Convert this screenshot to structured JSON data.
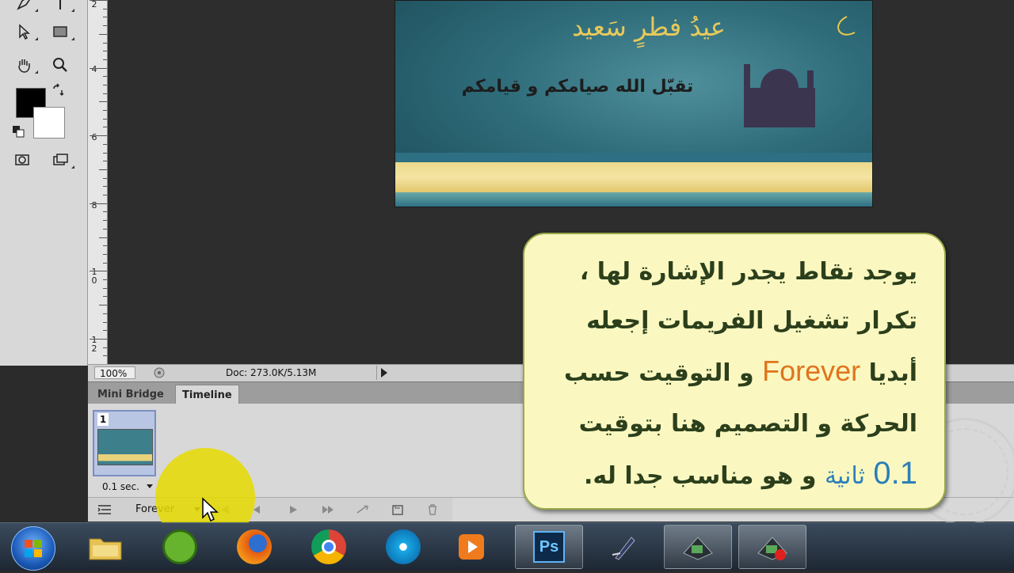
{
  "ruler": {
    "labels": [
      "2",
      "4",
      "6",
      "8",
      "10",
      "12"
    ]
  },
  "banner": {
    "title": "عيدُ فطرٍ سَعيد",
    "subtitle": "تقبّل الله صيامكم و قيامكم"
  },
  "status": {
    "zoom": "100%",
    "doc": "Doc: 273.0K/5.13M"
  },
  "panels": {
    "tabs": [
      "Mini Bridge",
      "Timeline"
    ]
  },
  "timeline": {
    "frame_number": "1",
    "frame_delay": "0.1 sec.",
    "loop": "Forever"
  },
  "bubble": {
    "line1": "يوجد نقاط يجدر الإشارة لها ،",
    "line2": "تكرار تشغيل الفريمات إجعله",
    "line3_pre": "أبديا",
    "line3_accent": "Forever",
    "line3_post": "و التوقيت حسب",
    "line4": "الحركة و التصميم هنا بتوقيت",
    "line5_num": "0.1",
    "line5_accent": "ثانية",
    "line5_post": "و هو مناسب جدا له."
  },
  "colors": {
    "bubble_bg": "#faf8c0",
    "accent_orange": "#e0741d",
    "accent_blue": "#2d7fb8",
    "highlight": "#e6dc00"
  },
  "icons": {
    "taskbar": [
      "windows-start-icon",
      "file-explorer-icon",
      "utorrent-icon",
      "firefox-icon",
      "chrome-icon",
      "media-player-icon",
      "play-icon",
      "photoshop-icon",
      "pen-tool-icon",
      "app-window-icon",
      "app-window-record-icon"
    ]
  }
}
